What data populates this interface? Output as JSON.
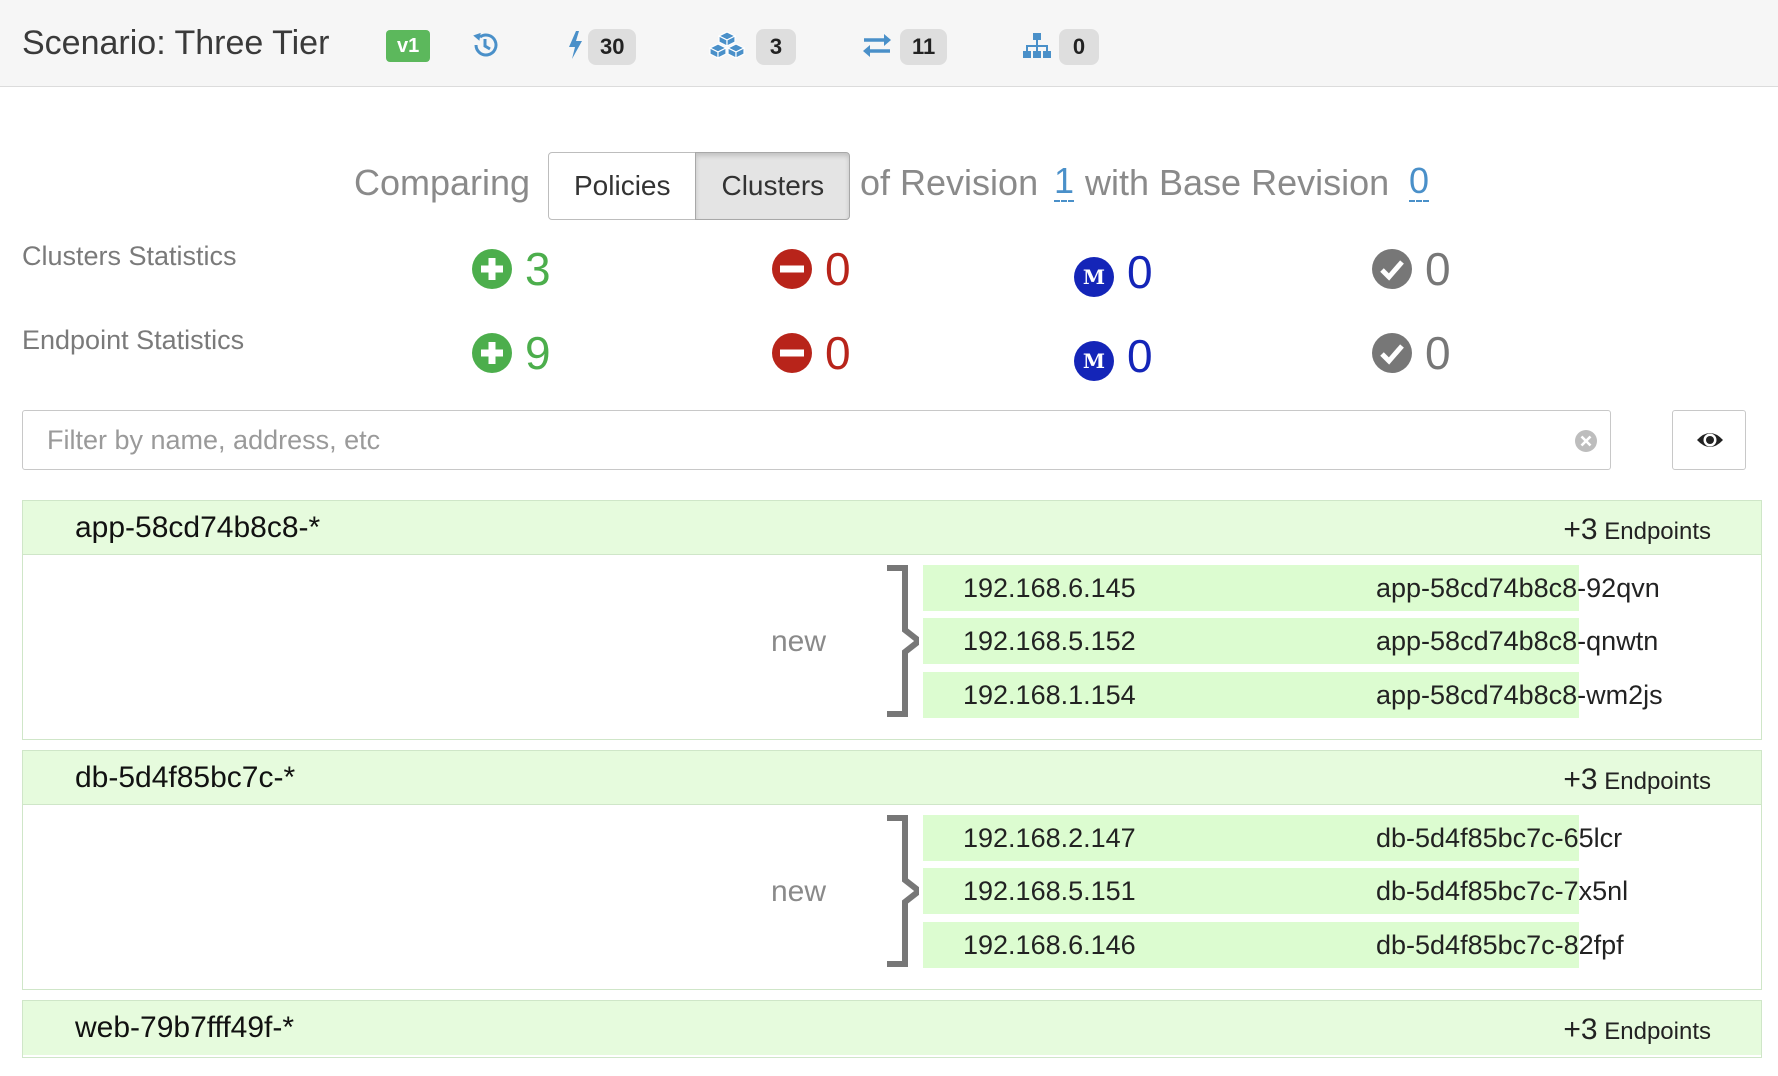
{
  "header": {
    "title": "Scenario: Three Tier",
    "version_badge": "v1",
    "counts": {
      "policies": "30",
      "clusters": "3",
      "connections": "11",
      "hierarchy": "0"
    }
  },
  "compare": {
    "label": "Comparing",
    "tabs": [
      "Policies",
      "Clusters"
    ],
    "active_tab": "Clusters",
    "of_revision_label": "of Revision",
    "revision": "1",
    "with_base_label": "with Base Revision",
    "base_revision": "0"
  },
  "stats": {
    "clusters": {
      "label": "Clusters Statistics",
      "added": "3",
      "removed": "0",
      "modified": "0",
      "unchanged": "0"
    },
    "endpoints": {
      "label": "Endpoint Statistics",
      "added": "9",
      "removed": "0",
      "modified": "0",
      "unchanged": "0"
    }
  },
  "filter": {
    "placeholder": "Filter by name, address, etc",
    "value": ""
  },
  "clusters": [
    {
      "name": "app-58cd74b8c8-*",
      "count_prefix": "+3",
      "count_label": "Endpoints",
      "status": "new",
      "endpoints": [
        {
          "ip": "192.168.6.145",
          "name": "app-58cd74b8c8-92qvn"
        },
        {
          "ip": "192.168.5.152",
          "name": "app-58cd74b8c8-qnwtn"
        },
        {
          "ip": "192.168.1.154",
          "name": "app-58cd74b8c8-wm2js"
        }
      ]
    },
    {
      "name": "db-5d4f85bc7c-*",
      "count_prefix": "+3",
      "count_label": "Endpoints",
      "status": "new",
      "endpoints": [
        {
          "ip": "192.168.2.147",
          "name": "db-5d4f85bc7c-65lcr"
        },
        {
          "ip": "192.168.5.151",
          "name": "db-5d4f85bc7c-7x5nl"
        },
        {
          "ip": "192.168.6.146",
          "name": "db-5d4f85bc7c-82fpf"
        }
      ]
    },
    {
      "name": "web-79b7fff49f-*",
      "count_prefix": "+3",
      "count_label": "Endpoints"
    }
  ],
  "colors": {
    "added": "#4cae4c",
    "removed": "#b8241a",
    "modified": "#1425b8",
    "unchanged": "#777777",
    "row_highlight": "#dcfcd0",
    "link": "#4a90c9"
  },
  "icons": {
    "revision_history": "history-icon",
    "policies": "bolt-icon",
    "clusters": "cubes-icon",
    "connections": "exchange-icon",
    "hierarchy": "sitemap-icon",
    "added": "plus-circle-icon",
    "removed": "minus-circle-icon",
    "modified": "m-circle-icon",
    "unchanged": "check-circle-icon",
    "clear": "clear-icon",
    "toggle_view": "eye-icon"
  }
}
